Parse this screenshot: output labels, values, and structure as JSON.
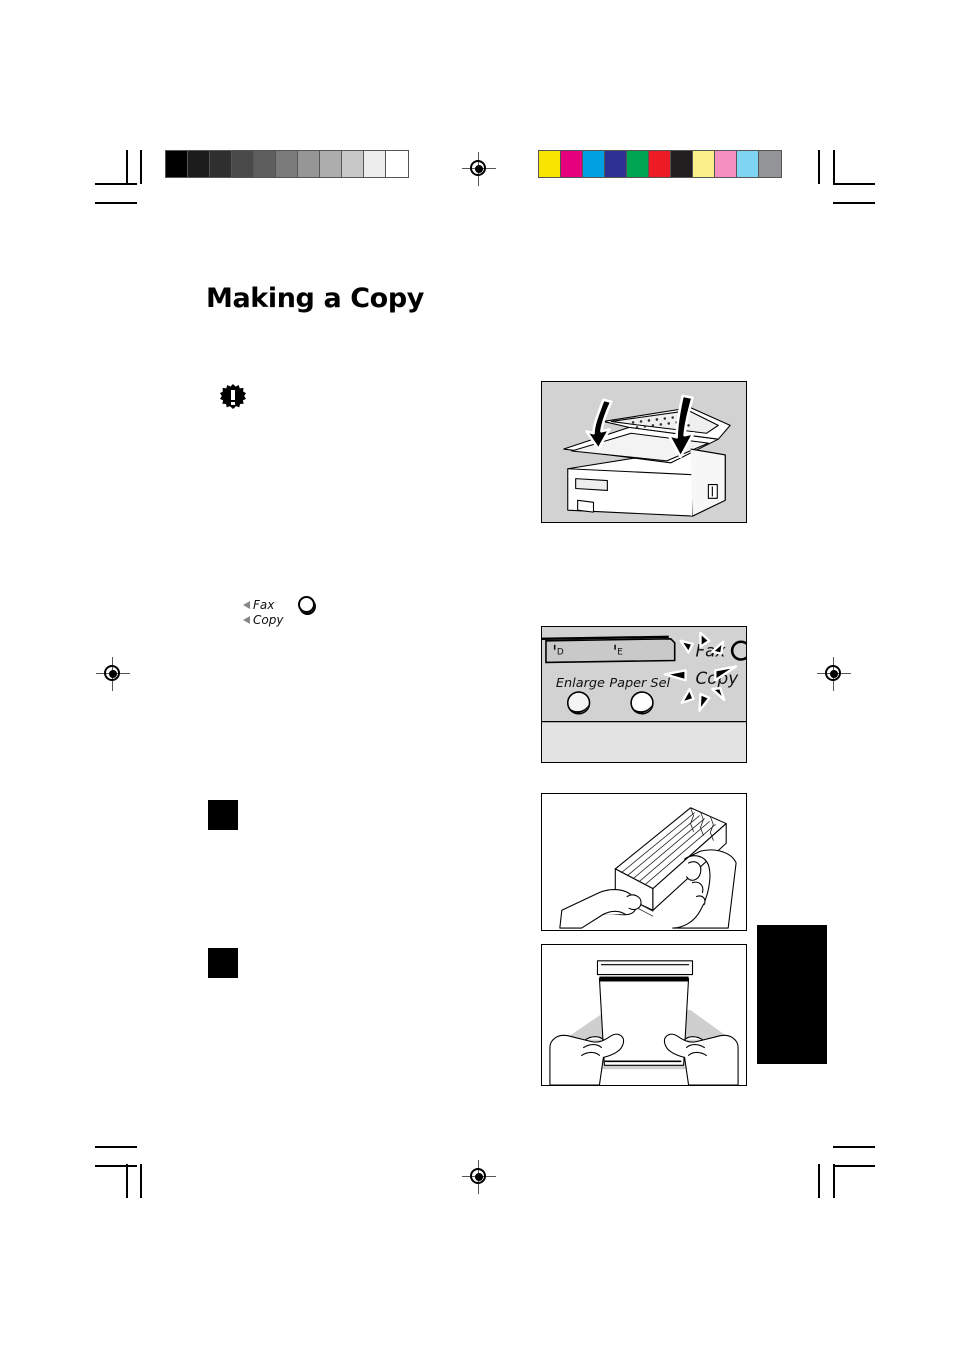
{
  "document": {
    "title": "Making a Copy",
    "page_background": "#ffffff"
  },
  "print_marks": {
    "grayscale_bar": {
      "name": "grayscale-calibration-bar",
      "steps": [
        "#000000",
        "#1c1c1c",
        "#2f2f2f",
        "#4a4a4a",
        "#5e5e5e",
        "#7b7b7b",
        "#969696",
        "#adadad",
        "#c8c8c8",
        "#ededed",
        "#ffffff"
      ]
    },
    "color_bar": {
      "name": "color-calibration-bar",
      "swatches": [
        "#f9e300",
        "#e6007e",
        "#00a0e3",
        "#2e3192",
        "#00a551",
        "#ed1c24",
        "#231f20",
        "#fbef8a",
        "#f48fc0",
        "#7fd4f4",
        "#929497"
      ]
    },
    "registration_mark": "registration-target"
  },
  "notice": {
    "icon": "important-burst-icon",
    "symbol": "!"
  },
  "control_legend": {
    "rows": [
      {
        "arrow": "left-arrow-marker",
        "label": "Fax"
      },
      {
        "arrow": "left-arrow-marker",
        "label": "Copy"
      }
    ],
    "indicator": "led-indicator-circle"
  },
  "steps": [
    {
      "marker": "step-number-square-1"
    },
    {
      "marker": "step-number-square-2"
    }
  ],
  "figures": [
    {
      "id": "fig-machine-close-covers",
      "caption_name": "figure-fax-machine-arrows",
      "kind": "gray-panel",
      "description": "Fax machine with two downward arrows pointing at the document feeder and cover"
    },
    {
      "id": "fig-control-panel",
      "caption_name": "figure-control-panel-copy-key",
      "kind": "gray-panel",
      "labels": {
        "scale_d": "D",
        "scale_e": "E",
        "enlarge": "Enlarge",
        "paper_select": "Paper Sel",
        "fax": "Fax",
        "copy": "Copy"
      },
      "indicator": "flashing-starburst"
    },
    {
      "id": "fig-fan-paper",
      "caption_name": "figure-fan-paper-stack",
      "kind": "white-panel",
      "description": "Two hands fanning a stack of paper"
    },
    {
      "id": "fig-load-paper",
      "caption_name": "figure-load-paper-tray",
      "kind": "white-panel",
      "description": "Two hands loading a paper stack into the cassette"
    }
  ],
  "thumb_tab": {
    "name": "chapter-thumb-tab",
    "color": "#000000"
  }
}
